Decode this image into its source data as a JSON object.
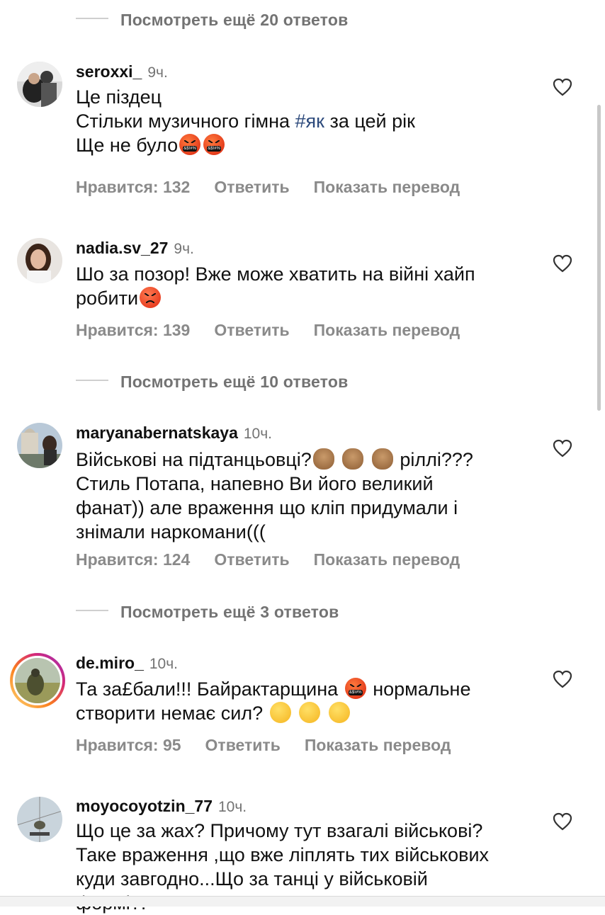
{
  "view_more": [
    {
      "label": "Посмотреть ещё 20 ответов"
    },
    {
      "label": "Посмотреть ещё 10 ответов"
    },
    {
      "label": "Посмотреть ещё 3 ответов"
    }
  ],
  "comments": [
    {
      "username": "seroxxi_",
      "time": "9ч.",
      "lines": [
        "Це піздец",
        "Стільки музичного гімна ",
        "#як",
        " за цей рік",
        "Ще не було"
      ],
      "likes": "Нравится: 132",
      "reply": "Ответить",
      "translate": "Показать перевод"
    },
    {
      "username": "nadia.sv_27",
      "time": "9ч.",
      "lines": [
        "Шо за позор! Вже може хватить на війні хайп",
        "робити"
      ],
      "likes": "Нравится: 139",
      "reply": "Ответить",
      "translate": "Показать перевод"
    },
    {
      "username": "maryanabernatskaya",
      "time": "10ч.",
      "lines": [
        "Військові на підтанцьовці?",
        " ріллі???",
        "Стиль Потапа, напевно Ви його великий",
        "фанат)) але враження що кліп придумали і",
        "знімали наркомани((("
      ],
      "likes": "Нравится: 124",
      "reply": "Ответить",
      "translate": "Показать перевод"
    },
    {
      "username": "de.miro_",
      "time": "10ч.",
      "lines": [
        "Та за£бали!!! Байрактарщина ",
        " нормальне",
        "створити немає сил? "
      ],
      "likes": "Нравится: 95",
      "reply": "Ответить",
      "translate": "Показать перевод"
    },
    {
      "username": "moyocoyotzin_77",
      "time": "10ч.",
      "lines": [
        "Що це за жах? Причому тут взагалі військові?",
        "Таке враження ,що вже ліплять тих військових",
        "куди завгодно...Що за танці у військовій",
        "формі?!"
      ]
    }
  ],
  "icons": {
    "heart": "heart-outline-icon"
  },
  "colors": {
    "secondary_text": "#737373",
    "hashtag": "#2d4a7c",
    "story_ring": "#d62976"
  }
}
